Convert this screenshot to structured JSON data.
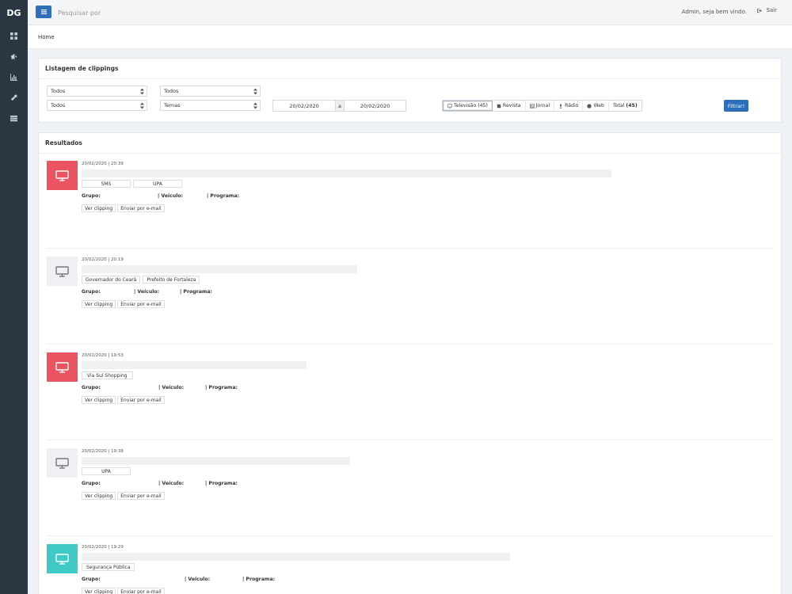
{
  "sidebar": {
    "logo": "DG"
  },
  "topbar": {
    "search_placeholder": "Pesquisar por",
    "welcome": "Admin, seja bem vindo.",
    "logout": "Sair"
  },
  "breadcrumb": "Home",
  "filters": {
    "title": "Listagem de clippings",
    "select1": "Todos",
    "select2": "Todos",
    "select3": "Todos",
    "select4": "Temas",
    "date_from": "20/02/2020",
    "date_sep": "a",
    "date_to": "20/02/2020",
    "media_tabs": {
      "tv": "Televisão (45)",
      "revista": "Revista",
      "jornal": "Jornal",
      "radio": "Rádio",
      "web": "Web",
      "total_label": "Total",
      "total_count": "(45)"
    },
    "filter_button": "Filtrar!"
  },
  "results": {
    "title": "Resultados",
    "labels": {
      "grupo": "Grupo:",
      "veiculo": "| Veículo:",
      "programa": "| Programa:"
    },
    "actions": {
      "view": "Ver clipping",
      "email": "Enviar por e-mail"
    },
    "items": [
      {
        "time": "20/02/2020 | 20:39",
        "tags": [
          "SMS",
          "UPA"
        ],
        "thumb_color": "#ea5460"
      },
      {
        "time": "20/02/2020 | 20:19",
        "tags": [
          "Governador do Ceará",
          "Prefeito de Fortaleza"
        ],
        "thumb_color": "#eef0f3"
      },
      {
        "time": "20/02/2020 | 19:53",
        "tags": [
          "Via Sul Shopping"
        ],
        "thumb_color": "#ea5460"
      },
      {
        "time": "20/02/2020 | 19:38",
        "tags": [
          "UPA"
        ],
        "thumb_color": "#eef0f3"
      },
      {
        "time": "20/02/2020 | 19:29",
        "tags": [
          "Segurança Pública"
        ],
        "thumb_color": "#3fc9c7"
      }
    ]
  }
}
